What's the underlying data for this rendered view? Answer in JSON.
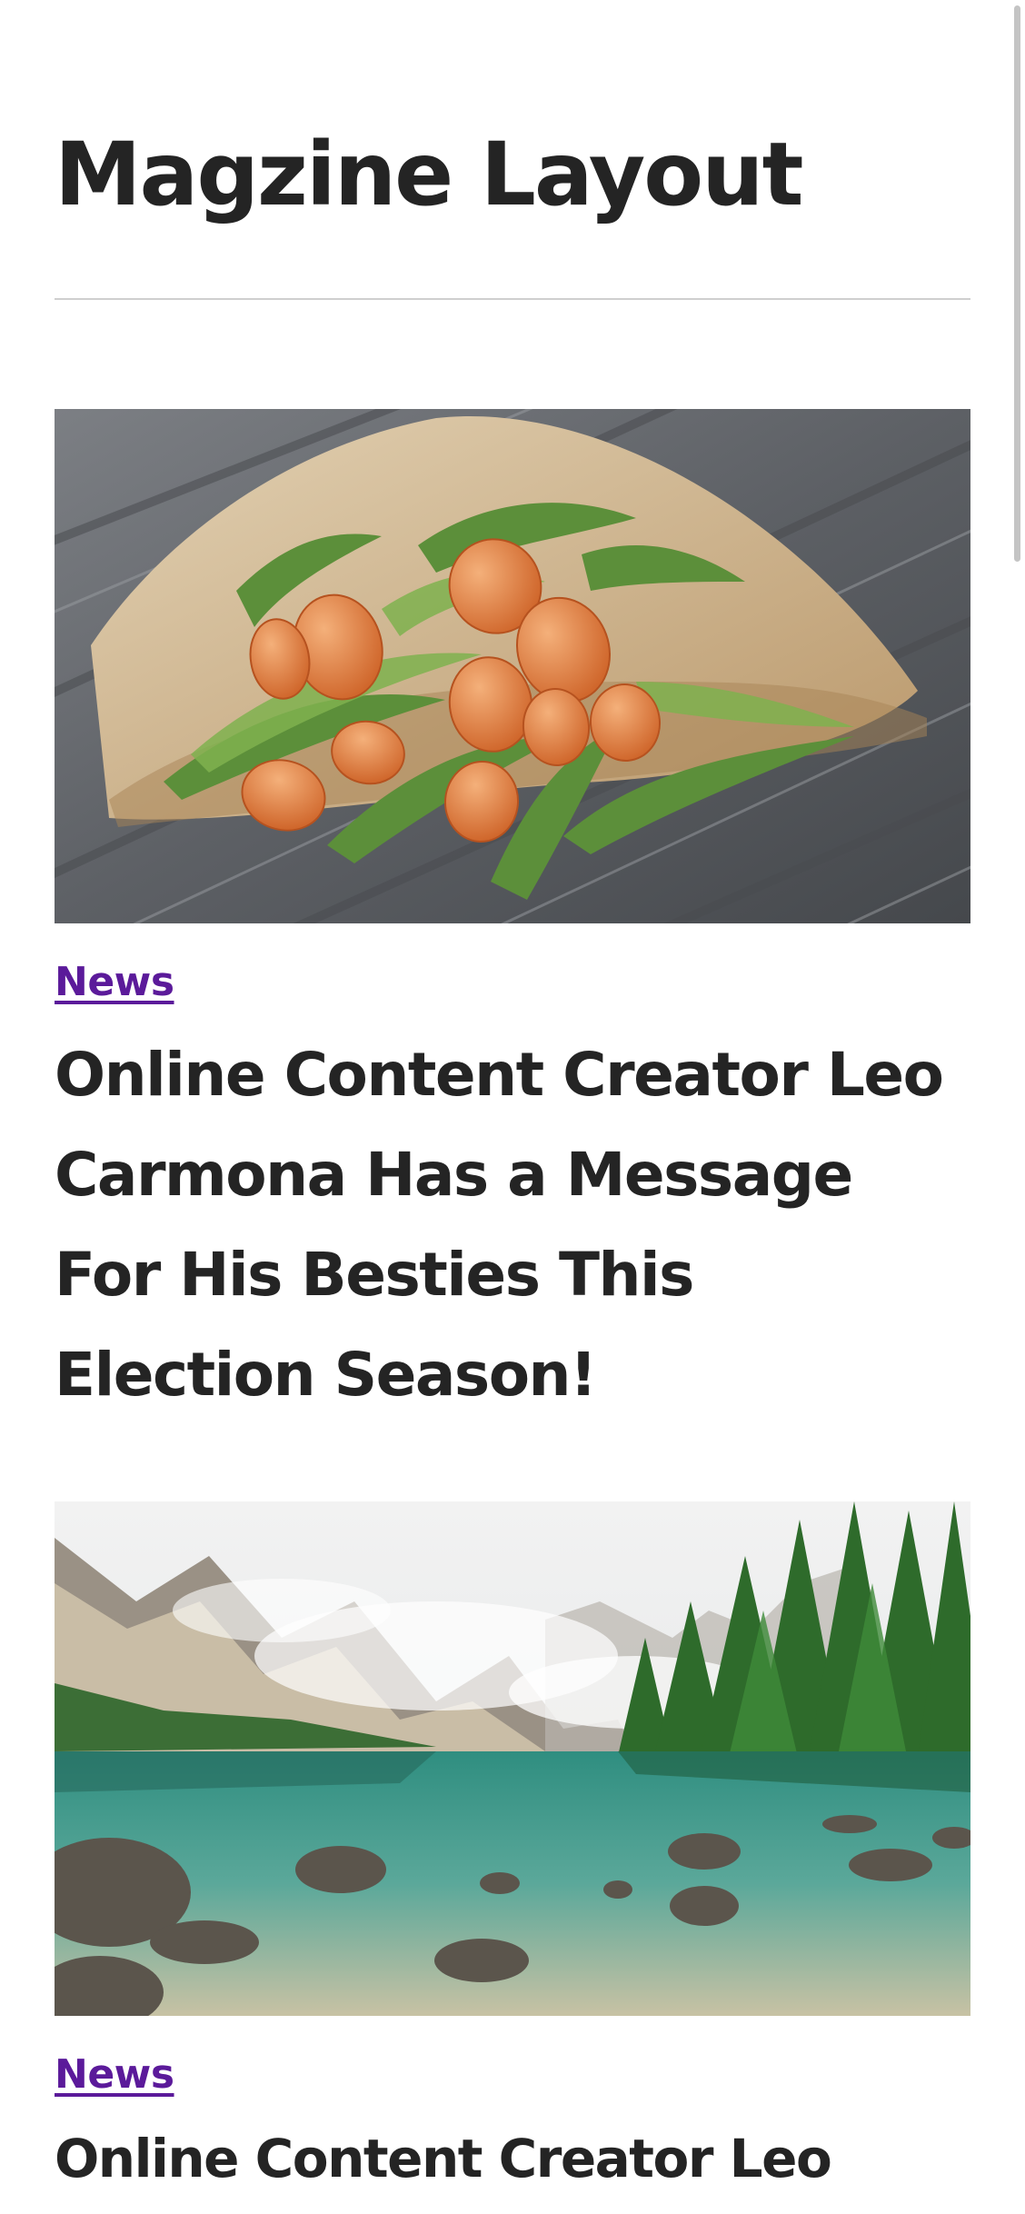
{
  "page": {
    "title": "Magzine Layout"
  },
  "articles": [
    {
      "category": "News",
      "headline": "Online Content Creator Leo Carmona Has a Message For His Besties This Election Season!",
      "image": "tulip-bouquet-photo"
    },
    {
      "category": "News",
      "headline": "Online Content Creator Leo",
      "image": "mountain-lake-photo"
    }
  ],
  "colors": {
    "text": "#242424",
    "category_link": "#5b1a9a",
    "divider": "#cfcfcf",
    "background": "#ffffff"
  }
}
